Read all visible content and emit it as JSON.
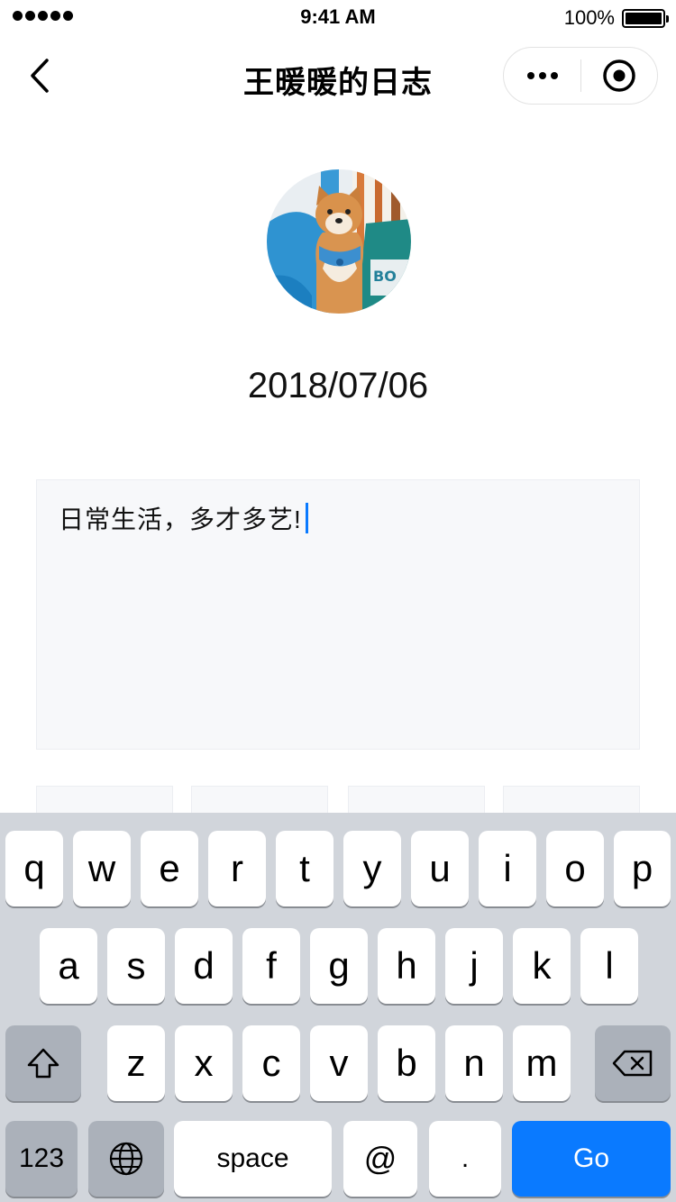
{
  "status_bar": {
    "time": "9:41 AM",
    "battery": "100%"
  },
  "nav": {
    "title": "王暖暖的日志",
    "back_icon": "chevron-left-icon",
    "more_icon": "more-dots-icon",
    "close_icon": "target-circle-icon"
  },
  "profile": {
    "avatar_icon": "shiba-dog-avatar",
    "date": "2018/07/06"
  },
  "editor": {
    "text": "日常生活，多才多艺!"
  },
  "keyboard": {
    "row1": [
      "q",
      "w",
      "e",
      "r",
      "t",
      "y",
      "u",
      "i",
      "o",
      "p"
    ],
    "row2": [
      "a",
      "s",
      "d",
      "f",
      "g",
      "h",
      "j",
      "k",
      "l"
    ],
    "row3": [
      "z",
      "x",
      "c",
      "v",
      "b",
      "n",
      "m"
    ],
    "numbers_label": "123",
    "space_label": "space",
    "at_label": "@",
    "dot_label": ".",
    "go_label": "Go"
  },
  "colors": {
    "accent": "#0a7aff",
    "keyboard_bg": "#d1d5db",
    "editor_bg": "#f7f8fa"
  }
}
